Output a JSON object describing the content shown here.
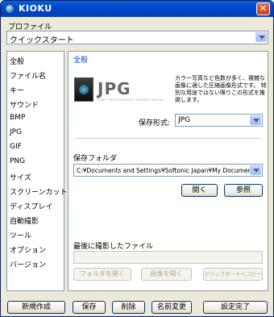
{
  "window": {
    "title": "KIOKU",
    "close_glyph": "✕"
  },
  "profile": {
    "label": "プロファイル",
    "selected": "クイックスタート"
  },
  "sidebar": {
    "items": [
      "全般",
      "ファイル名",
      "キー",
      "サウンド",
      "BMP",
      "JPG",
      "GIF",
      "PNG",
      "サイズ",
      "スクリーンカット",
      "ディスプレイ",
      "自動撮影",
      "ツール",
      "オプション",
      "バージョン"
    ]
  },
  "panel": {
    "section_title": "全般",
    "banner": {
      "logo": "JPG",
      "subtitle": "JOINT PHOTOGRAPHIC EXPERTS GROUP"
    },
    "description": "カラー写真など色数が多く、複雑な画像に適した圧縮画像形式です。 特別な用途ではない限りこの形式を推奨します。",
    "format": {
      "label": "保存形式:",
      "selected": "JPG"
    },
    "folder": {
      "label": "保存フォルダ",
      "path": "C:¥Documents and Settings¥Softonic Japan¥My Documents",
      "open_button": "開く",
      "browse_button": "参照"
    },
    "last_file": {
      "label": "最後に撮影したファイル",
      "value": "",
      "open_folder_button": "フォルダを開く",
      "open_image_button": "画像を開く",
      "copy_clipboard_button": "クリップボードへコピー"
    }
  },
  "footer": {
    "new_button": "新規作成",
    "save_button": "保存",
    "delete_button": "削除",
    "rename_button": "名前変更",
    "finish_button": "設定完了"
  },
  "colors": {
    "titlebar": "#0049c9",
    "accent_text": "#0046d5",
    "window_bg": "#ece9d8"
  }
}
